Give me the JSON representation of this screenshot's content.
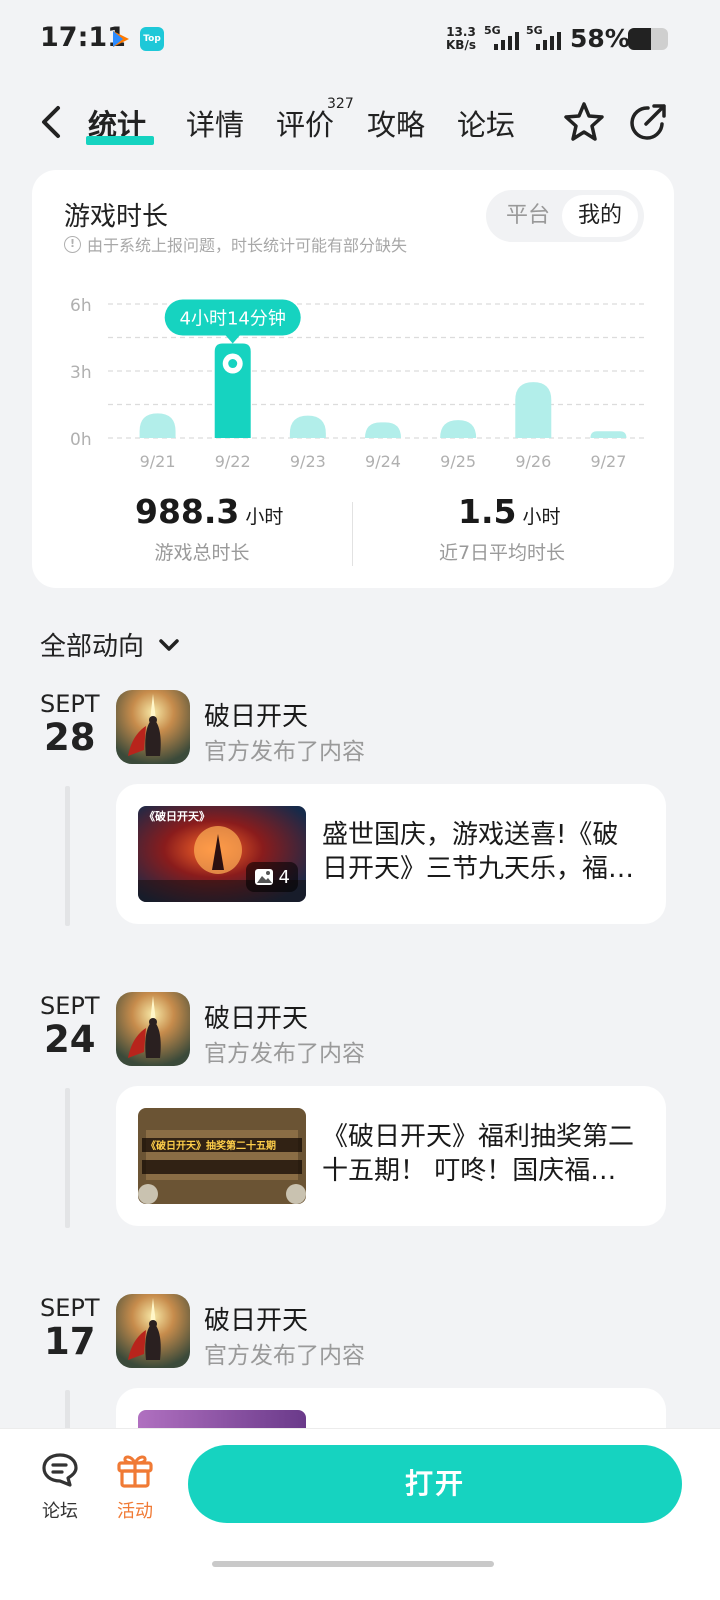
{
  "status_bar": {
    "time": "17:11",
    "net_speed_value": "13.3",
    "net_speed_unit": "KB/s",
    "sim1": "5G",
    "sim2": "5G",
    "battery_percent": "58%",
    "battery_level": 0.58
  },
  "header": {
    "tabs": [
      {
        "label": "统计",
        "active": true
      },
      {
        "label": "详情"
      },
      {
        "label": "评价",
        "badge": "327"
      },
      {
        "label": "攻略"
      },
      {
        "label": "论坛"
      }
    ]
  },
  "stats_card": {
    "title": "游戏时长",
    "note": "由于系统上报问题，时长统计可能有部分缺失",
    "segment": {
      "options": [
        "平台",
        "我的"
      ],
      "selected": "我的"
    },
    "tooltip": "4小时14分钟",
    "total_value": "988.3",
    "total_unit": "小时",
    "total_label": "游戏总时长",
    "avg_value": "1.5",
    "avg_unit": "小时",
    "avg_label": "近7日平均时长"
  },
  "chart_data": {
    "type": "bar",
    "categories": [
      "9/21",
      "9/22",
      "9/23",
      "9/24",
      "9/25",
      "9/26",
      "9/27"
    ],
    "values": [
      1.1,
      4.23,
      1.0,
      0.7,
      0.8,
      2.5,
      0.3
    ],
    "highlighted_index": 1,
    "ytick_labels": [
      "6h",
      "3h",
      "0h"
    ],
    "yticks": [
      6,
      3,
      0
    ],
    "ylim": [
      0,
      6
    ],
    "grid": true,
    "colors": {
      "bar": "#b2eeea",
      "highlight": "#16d3c0",
      "grid": "#dcdcdc"
    }
  },
  "feed": {
    "title": "全部动向",
    "items": [
      {
        "month": "SEPT",
        "day": "28",
        "game": "破日开天",
        "action": "官方发布了内容",
        "text": "盛世国庆，游戏送喜!《破日开天》三节九天乐，福利狂欢",
        "image_count": "4",
        "thumb_caption": "《破日开天》"
      },
      {
        "month": "SEPT",
        "day": "24",
        "game": "破日开天",
        "action": "官方发布了内容",
        "text": "《破日开天》福利抽奖第二十五期！ 叮咚！国庆福利来袭",
        "thumb_caption": "《破日开天》抽奖第二十五期"
      },
      {
        "month": "SEPT",
        "day": "17",
        "game": "破日开天",
        "action": "官方发布了内容"
      }
    ]
  },
  "bottom_bar": {
    "forum_label": "论坛",
    "activity_label": "活动",
    "open_label": "打开"
  },
  "colors": {
    "accent": "#16d3c0",
    "activity": "#f07a35"
  }
}
